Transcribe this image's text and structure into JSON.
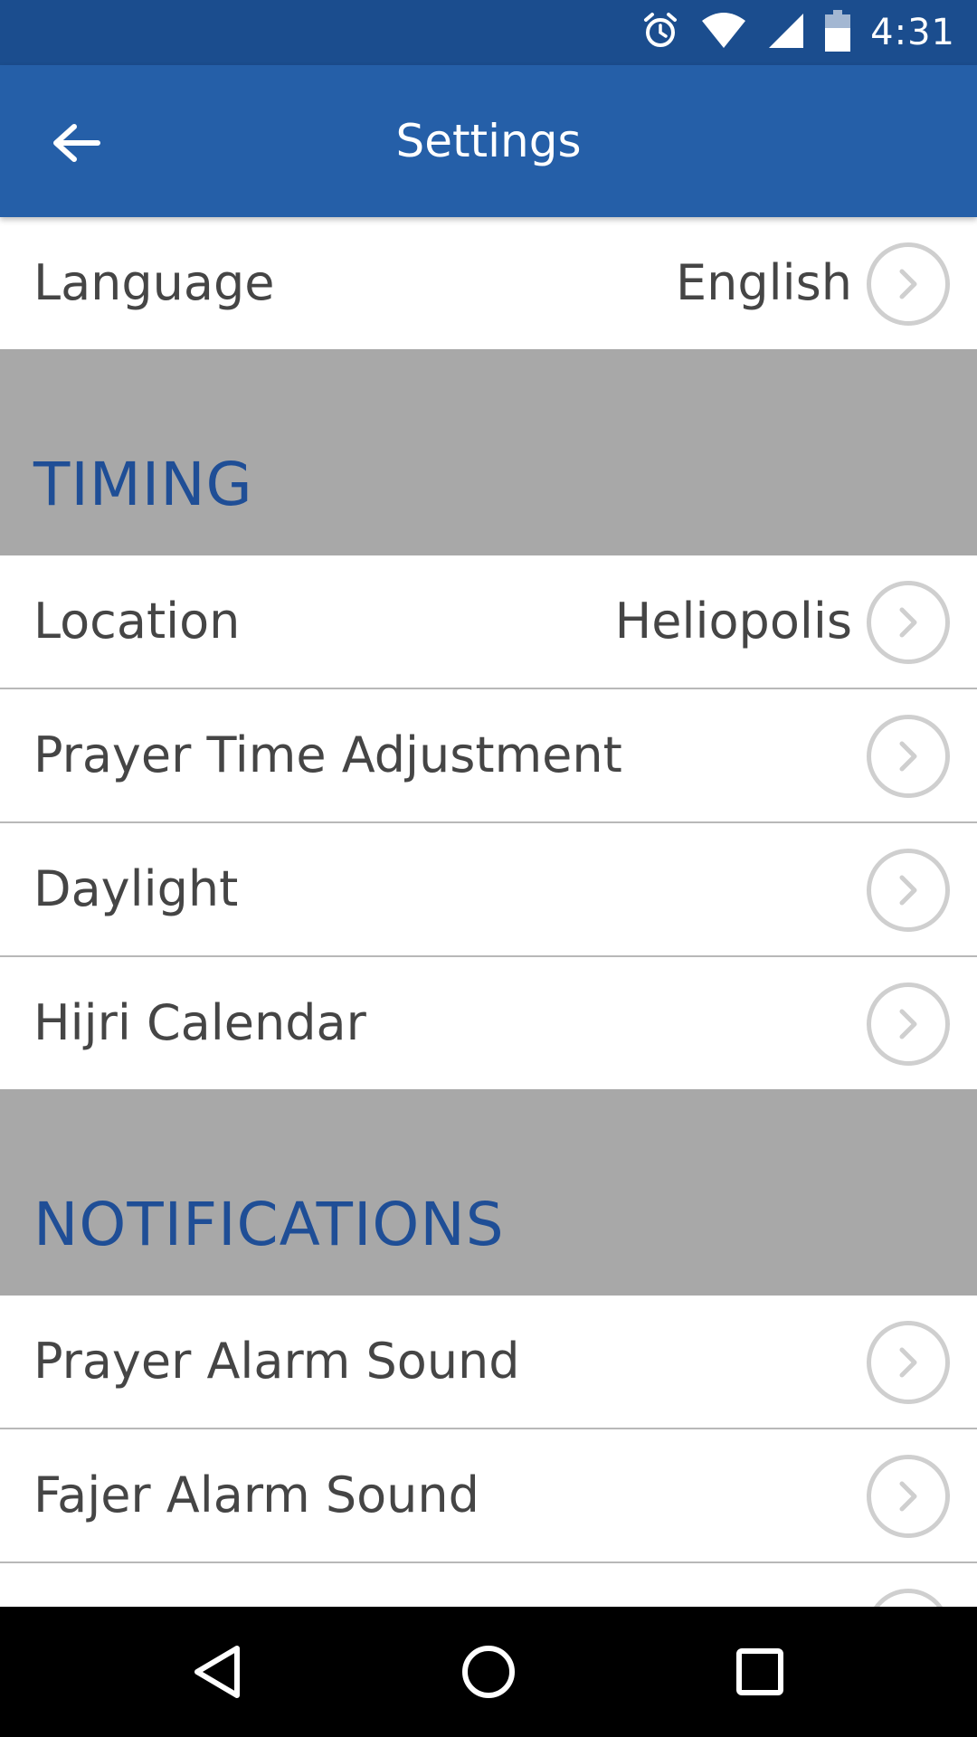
{
  "status_bar": {
    "time": "4:31",
    "icons": [
      "alarm-icon",
      "wifi-icon",
      "signal-icon",
      "battery-icon"
    ]
  },
  "app_bar": {
    "title": "Settings",
    "back_icon": "arrow-left-icon"
  },
  "language_row": {
    "label": "Language",
    "value": "English"
  },
  "timing_section": {
    "header": "TIMING",
    "items": [
      {
        "label": "Location",
        "value": "Heliopolis"
      },
      {
        "label": "Prayer Time Adjustment",
        "value": ""
      },
      {
        "label": "Daylight",
        "value": ""
      },
      {
        "label": "Hijri Calendar",
        "value": ""
      }
    ]
  },
  "notifications_section": {
    "header": "NOTIFICATIONS",
    "items": [
      {
        "label": "Prayer Alarm Sound",
        "value": ""
      },
      {
        "label": "Fajer Alarm Sound",
        "value": ""
      }
    ]
  },
  "nav_bar": {
    "icons": [
      "back-triangle-icon",
      "home-circle-icon",
      "recents-square-icon"
    ]
  },
  "colors": {
    "status_bar": "#1b4d8e",
    "app_bar": "#255fa8",
    "section_bg": "#a8a8a8",
    "section_text": "#1f4e96",
    "row_text": "#454545",
    "chevron": "#cfcfcf"
  }
}
